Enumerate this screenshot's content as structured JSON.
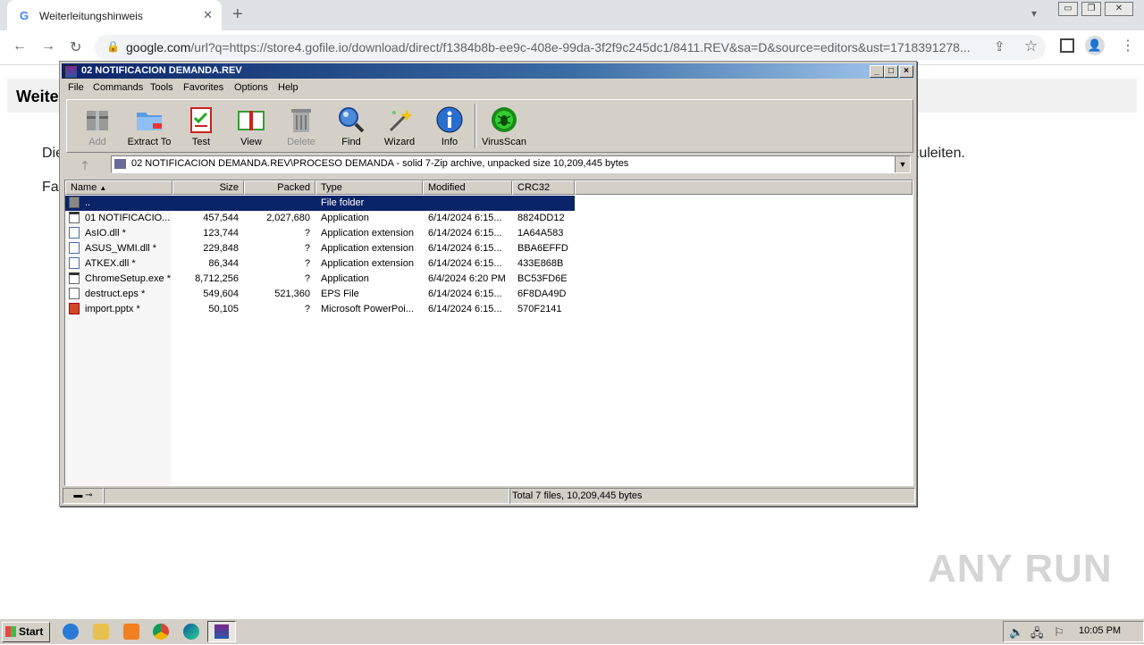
{
  "browser": {
    "tab_title": "Weiterleitungshinweis",
    "tab_favicon": "G",
    "tab_close": "✕",
    "new_tab": "+",
    "url_main": "google.com",
    "url_rest": "/url?q=https://store4.gofile.io/download/direct/f1384b8b-ee9c-408e-99da-3f2f9c245dc1/8411.REV&sa=D&source=editors&ust=1718391278...",
    "icons": [
      "back-icon",
      "forward-icon",
      "reload-icon",
      "lock-icon",
      "share-icon",
      "star-icon",
      "side-panel-icon",
      "profile-icon",
      "menu-icon"
    ]
  },
  "page": {
    "heading": "Weite",
    "line1_start": "Die",
    "line1_end": "rzuleiten.",
    "line2_start": "Fa"
  },
  "winrar": {
    "title": "02 NOTIFICACION DEMANDA.REV",
    "menu": [
      "File",
      "Commands",
      "Tools",
      "Favorites",
      "Options",
      "Help"
    ],
    "tools": [
      {
        "label": "Add",
        "icon": "add-icon",
        "disabled": true
      },
      {
        "label": "Extract To",
        "icon": "extract-to-icon",
        "disabled": false
      },
      {
        "label": "Test",
        "icon": "test-icon",
        "disabled": false
      },
      {
        "label": "View",
        "icon": "view-icon",
        "disabled": false
      },
      {
        "label": "Delete",
        "icon": "delete-icon",
        "disabled": true
      },
      {
        "label": "Find",
        "icon": "find-icon",
        "disabled": false
      },
      {
        "label": "Wizard",
        "icon": "wizard-icon",
        "disabled": false
      },
      {
        "label": "Info",
        "icon": "info-icon",
        "disabled": false
      },
      {
        "label": "VirusScan",
        "icon": "virusscan-icon",
        "disabled": false
      }
    ],
    "path": "02 NOTIFICACION DEMANDA.REV\\PROCESO DEMANDA - solid 7-Zip archive, unpacked size 10,209,445 bytes",
    "columns": [
      "Name",
      "Size",
      "Packed",
      "Type",
      "Modified",
      "CRC32"
    ],
    "rows": [
      {
        "name": "..",
        "size": "",
        "packed": "",
        "type": "File folder",
        "modified": "",
        "crc": ""
      },
      {
        "name": "01 NOTIFICACIO...",
        "size": "457,544",
        "packed": "2,027,680",
        "type": "Application",
        "modified": "6/14/2024 6:15...",
        "crc": "8824DD12"
      },
      {
        "name": "AsIO.dll *",
        "size": "123,744",
        "packed": "?",
        "type": "Application extension",
        "modified": "6/14/2024 6:15...",
        "crc": "1A64A583"
      },
      {
        "name": "ASUS_WMI.dll *",
        "size": "229,848",
        "packed": "?",
        "type": "Application extension",
        "modified": "6/14/2024 6:15...",
        "crc": "BBA6EFFD"
      },
      {
        "name": "ATKEX.dll *",
        "size": "86,344",
        "packed": "?",
        "type": "Application extension",
        "modified": "6/14/2024 6:15...",
        "crc": "433E868B"
      },
      {
        "name": "ChromeSetup.exe *",
        "size": "8,712,256",
        "packed": "?",
        "type": "Application",
        "modified": "6/4/2024 6:20 PM",
        "crc": "BC53FD6E"
      },
      {
        "name": "destruct.eps *",
        "size": "549,604",
        "packed": "521,360",
        "type": "EPS File",
        "modified": "6/14/2024 6:15...",
        "crc": "6F8DA49D"
      },
      {
        "name": "import.pptx *",
        "size": "50,105",
        "packed": "?",
        "type": "Microsoft PowerPoi...",
        "modified": "6/14/2024 6:15...",
        "crc": "570F2141"
      }
    ],
    "status": "Total 7 files, 10,209,445 bytes"
  },
  "watermark": "ANY RUN",
  "taskbar": {
    "start": "Start",
    "clock": "10:05 PM"
  }
}
